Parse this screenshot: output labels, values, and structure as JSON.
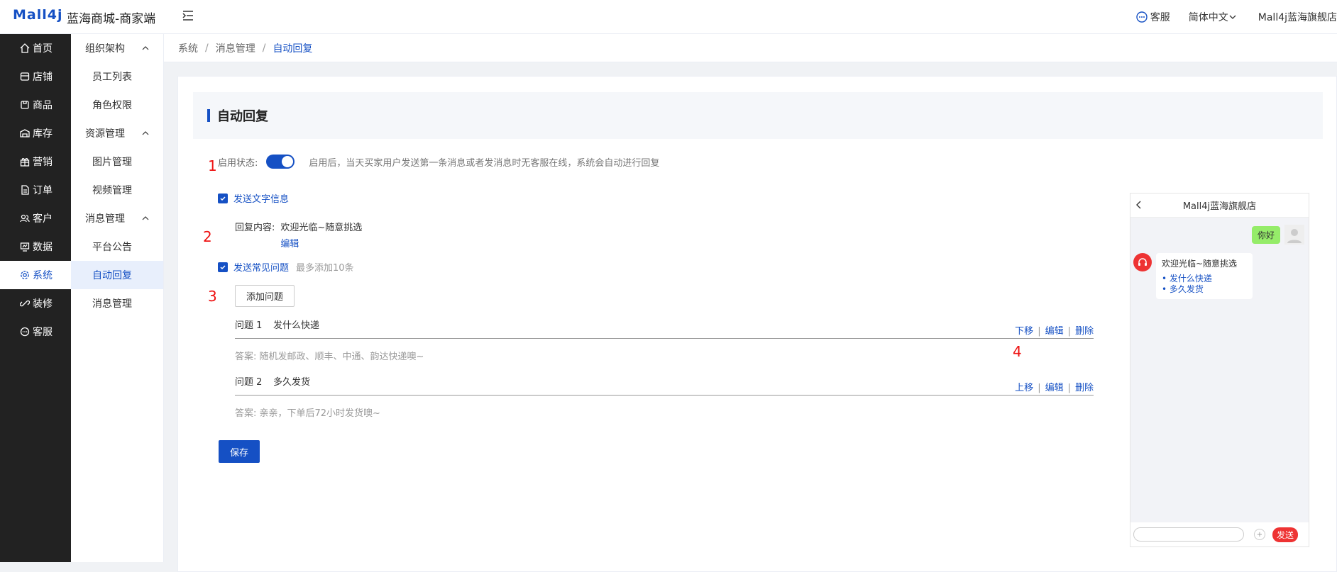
{
  "header": {
    "logo": "Mall4j",
    "app_name": "蓝海商城-商家端",
    "service": "客服",
    "language": "简体中文",
    "shop": "Mall4j蓝海旗舰店"
  },
  "sidebar": {
    "items": [
      {
        "label": "首页",
        "icon": "home-icon"
      },
      {
        "label": "店铺",
        "icon": "shop-icon"
      },
      {
        "label": "商品",
        "icon": "product-icon"
      },
      {
        "label": "库存",
        "icon": "stock-icon"
      },
      {
        "label": "营销",
        "icon": "gift-icon"
      },
      {
        "label": "订单",
        "icon": "order-icon"
      },
      {
        "label": "客户",
        "icon": "users-icon"
      },
      {
        "label": "数据",
        "icon": "chart-icon"
      },
      {
        "label": "系统",
        "icon": "gear-icon"
      },
      {
        "label": "装修",
        "icon": "link-icon"
      },
      {
        "label": "客服",
        "icon": "chat-icon"
      }
    ]
  },
  "submenu": {
    "groups": [
      {
        "label": "组织架构",
        "items": [
          "员工列表",
          "角色权限"
        ]
      },
      {
        "label": "资源管理",
        "items": [
          "图片管理",
          "视频管理"
        ]
      },
      {
        "label": "消息管理",
        "items": [
          "平台公告",
          "自动回复",
          "消息管理"
        ]
      }
    ]
  },
  "breadcrumb": [
    "系统",
    "消息管理",
    "自动回复"
  ],
  "page": {
    "title": "自动回复",
    "status_label": "启用状态:",
    "status_hint": "启用后，当天买家用户发送第一条消息或者发消息时无客服在线，系统会自动进行回复",
    "send_text_label": "发送文字信息",
    "reply_label": "回复内容:",
    "reply_value": "欢迎光临~随意挑选",
    "edit": "编辑",
    "send_faq_label": "发送常见问题",
    "faq_limit": "最多添加10条",
    "add_question": "添加问题",
    "questions": [
      {
        "no": "问题 1",
        "title": "发什么快递",
        "op1": "下移",
        "op2": "编辑",
        "op3": "删除",
        "answer": "答案: 随机发邮政、顺丰、中通、韵达快递噢~"
      },
      {
        "no": "问题 2",
        "title": "多久发货",
        "op1": "上移",
        "op2": "编辑",
        "op3": "删除",
        "answer": "答案: 亲亲，下单后72小时发货噢~"
      }
    ],
    "save": "保存",
    "annotations": [
      "1",
      "2",
      "3",
      "4"
    ]
  },
  "preview": {
    "shop": "Mall4j蓝海旗舰店",
    "out_msg": "你好",
    "in_msg": "欢迎光临~随意挑选",
    "links": [
      "• 发什么快递",
      "• 多久发货"
    ],
    "send": "发送",
    "plus": "+"
  },
  "colors": {
    "accent": "#1550c4",
    "sidebar_bg": "#222222",
    "send_red": "#ee3333",
    "bubble_green": "#95ec69"
  }
}
